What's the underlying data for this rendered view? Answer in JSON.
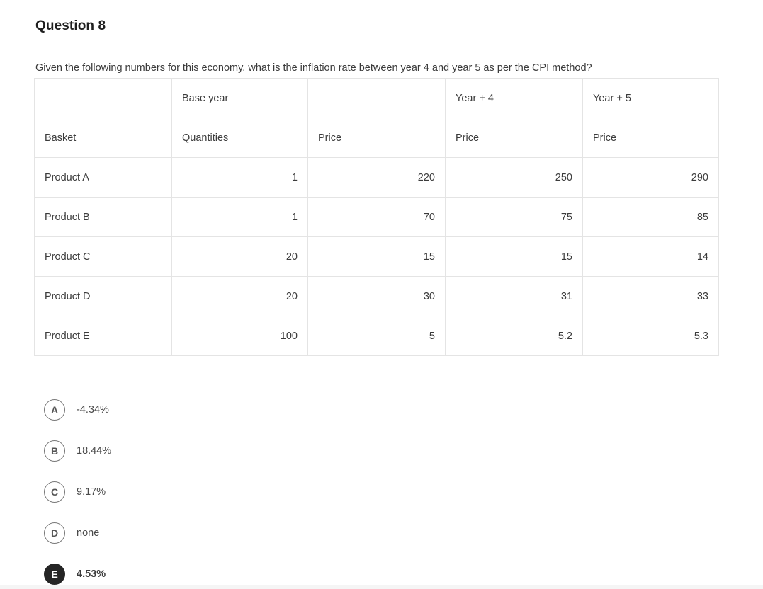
{
  "question": {
    "title": "Question 8",
    "prompt": "Given the following numbers for this economy, what is the inflation rate between year 4 and year 5 as per the CPI method?"
  },
  "table": {
    "header_top": [
      "",
      "Base year",
      "",
      "Year + 4",
      "Year + 5"
    ],
    "header_sub": [
      "Basket",
      "Quantities",
      "Price",
      "Price",
      "Price"
    ],
    "rows": [
      {
        "basket": "Product A",
        "quantities": "1",
        "base_price": "220",
        "year4_price": "250",
        "year5_price": "290"
      },
      {
        "basket": "Product B",
        "quantities": "1",
        "base_price": "70",
        "year4_price": "75",
        "year5_price": "85"
      },
      {
        "basket": "Product C",
        "quantities": "20",
        "base_price": "15",
        "year4_price": "15",
        "year5_price": "14"
      },
      {
        "basket": "Product D",
        "quantities": "20",
        "base_price": "30",
        "year4_price": "31",
        "year5_price": "33"
      },
      {
        "basket": "Product E",
        "quantities": "100",
        "base_price": "5",
        "year4_price": "5.2",
        "year5_price": "5.3"
      }
    ]
  },
  "options": [
    {
      "letter": "A",
      "label": "-4.34%",
      "selected": false
    },
    {
      "letter": "B",
      "label": "18.44%",
      "selected": false
    },
    {
      "letter": "C",
      "label": "9.17%",
      "selected": false
    },
    {
      "letter": "D",
      "label": "none",
      "selected": false
    },
    {
      "letter": "E",
      "label": "4.53%",
      "selected": true
    }
  ],
  "colors": {
    "text": "#3b3b3b",
    "border": "#e4e4e4",
    "selected_fill": "#252525",
    "bullet_border": "#777777"
  }
}
